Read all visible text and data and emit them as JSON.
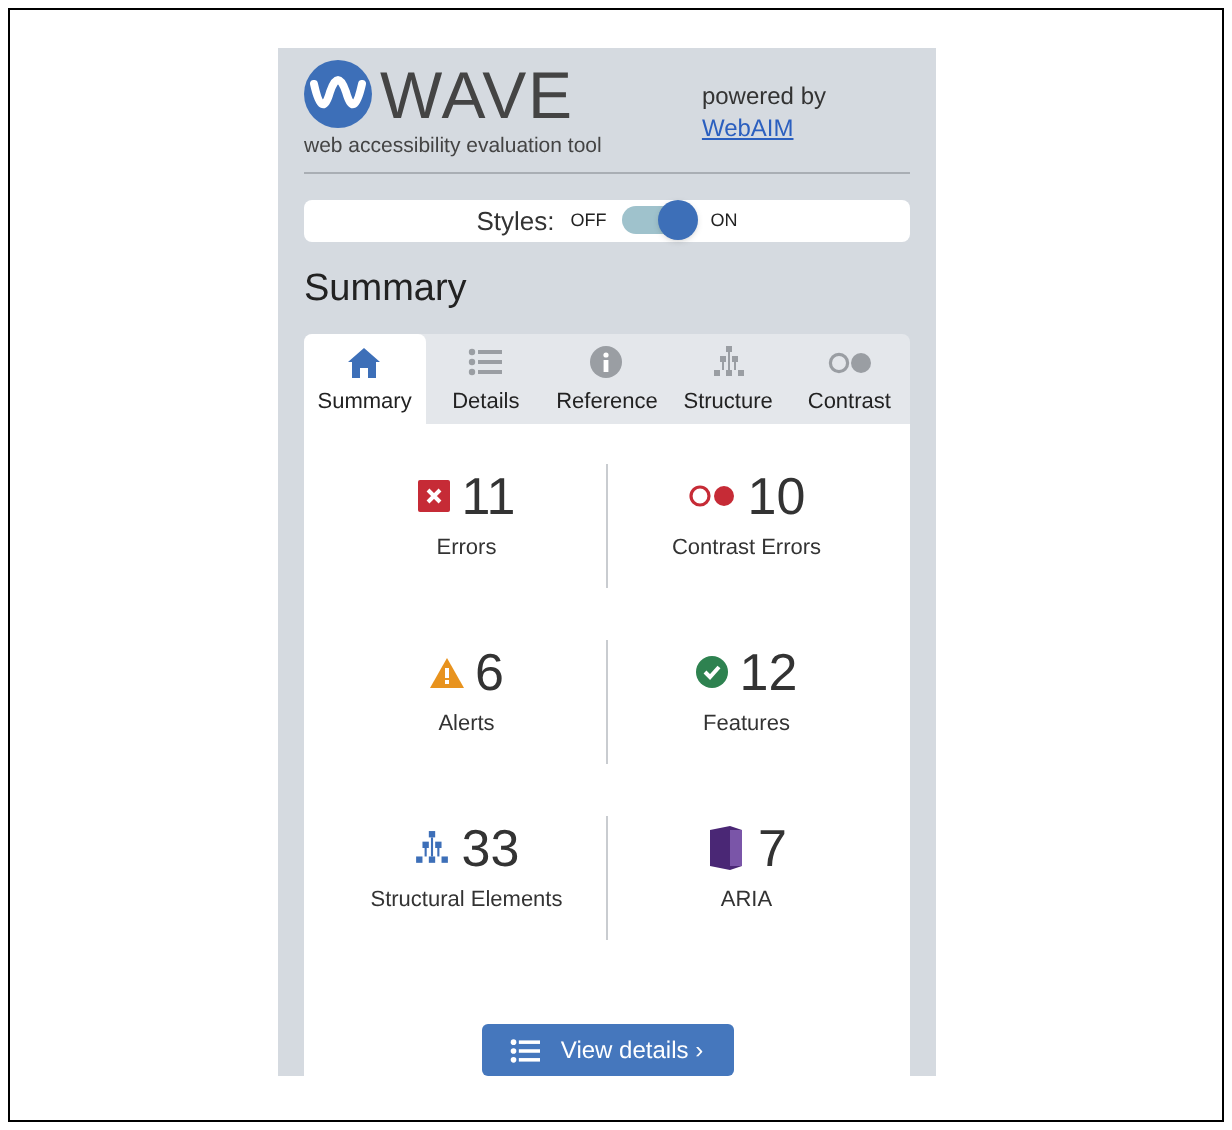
{
  "header": {
    "logo_text": "WAVE",
    "tagline": "web accessibility evaluation tool",
    "powered_by": "powered by",
    "link": "WebAIM"
  },
  "styles_toggle": {
    "label": "Styles:",
    "off_label": "OFF",
    "on_label": "ON",
    "on": true
  },
  "heading": "Summary",
  "tabs": [
    {
      "kind": "home",
      "label": "Summary",
      "selected": true
    },
    {
      "kind": "list",
      "label": "Details",
      "selected": false
    },
    {
      "kind": "info",
      "label": "Reference",
      "selected": false
    },
    {
      "kind": "structure",
      "label": "Structure",
      "selected": false
    },
    {
      "kind": "contrast",
      "label": "Contrast",
      "selected": false
    }
  ],
  "stats": [
    {
      "kind": "error",
      "count": "11",
      "label": "Errors"
    },
    {
      "kind": "contrast",
      "count": "10",
      "label": "Contrast Errors"
    },
    {
      "kind": "alert",
      "count": "6",
      "label": "Alerts"
    },
    {
      "kind": "feature",
      "count": "12",
      "label": "Features"
    },
    {
      "kind": "structure",
      "count": "33",
      "label": "Structural Elements"
    },
    {
      "kind": "aria",
      "count": "7",
      "label": "ARIA"
    }
  ],
  "button": "View details ›"
}
